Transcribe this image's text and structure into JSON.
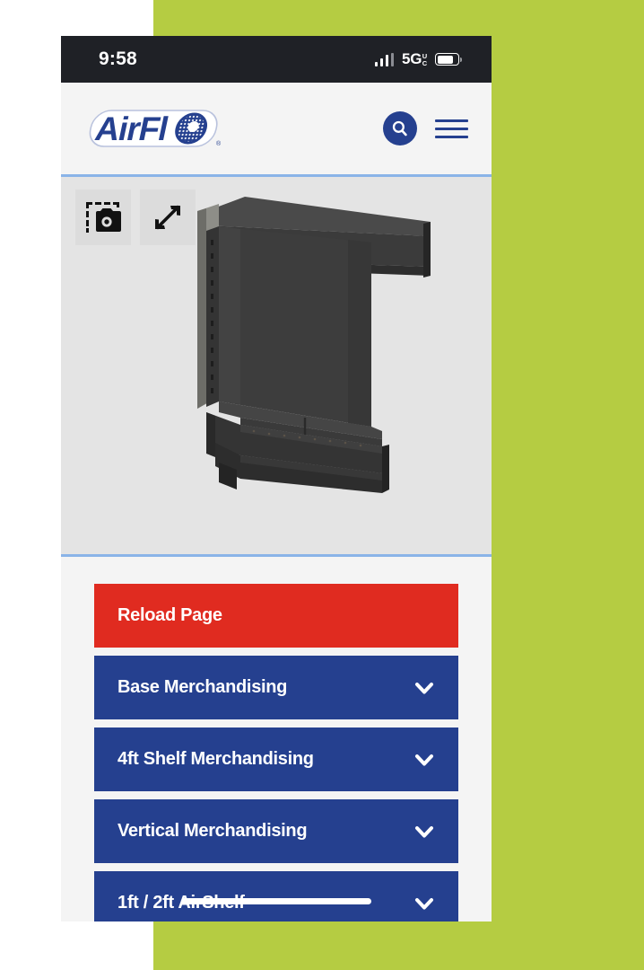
{
  "theme": {
    "backdrop_green": "#b5cc42",
    "page_background": "#ffffff",
    "brand_blue": "#25408f",
    "accent_red": "#e02b20",
    "divider_blue": "#8ab4e8",
    "image_backdrop": "#e4e4e4",
    "statusbar_background": "#1f2126",
    "site_background": "#f4f4f4"
  },
  "edge": {
    "clipped_text": "r"
  },
  "status_bar": {
    "time": "9:58",
    "network": "5G",
    "network_sub_top": "U",
    "network_sub_bottom": "C",
    "signal_icon": "cellular-bars-icon",
    "battery_icon": "battery-icon",
    "battery_level": "78%"
  },
  "header": {
    "logo_text": "AirFlo",
    "logo_trademark": "®",
    "search_icon": "search-icon",
    "menu_icon": "hamburger-menu-icon"
  },
  "image_zone": {
    "screenshot_tool_icon": "camera-screenshot-icon",
    "expand_tool_icon": "expand-diagonal-arrows-icon",
    "product_alt": "black retail gondola shelving display unit"
  },
  "panels": {
    "items": [
      {
        "label": "Reload Page",
        "style": "red",
        "has_chevron": false
      },
      {
        "label": "Base Merchandising",
        "style": "blue",
        "has_chevron": true,
        "chevron_icon": "chevron-down-icon"
      },
      {
        "label": "4ft Shelf Merchandising",
        "style": "blue",
        "has_chevron": true,
        "chevron_icon": "chevron-down-icon"
      },
      {
        "label": "Vertical Merchandising",
        "style": "blue",
        "has_chevron": true,
        "chevron_icon": "chevron-down-icon"
      },
      {
        "label": "1ft / 2ft AirShelf",
        "style": "blue",
        "has_chevron": true,
        "chevron_icon": "chevron-down-icon"
      }
    ]
  },
  "home_indicator": {
    "name": "home-indicator-bar"
  }
}
